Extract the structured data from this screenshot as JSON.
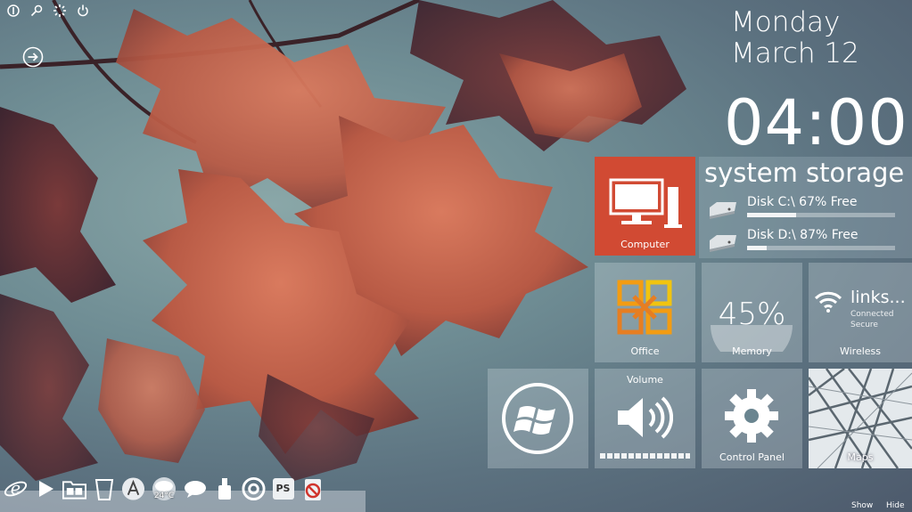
{
  "system_bar": {
    "icons": [
      "info-icon",
      "key-icon",
      "loading-spinner-icon",
      "power-icon"
    ],
    "back_icon": "circle-arrow-right-icon"
  },
  "date": {
    "day": "Monday",
    "month_day": "March 12"
  },
  "clock": {
    "time": "04:00"
  },
  "storage": {
    "title": "system storage",
    "disks": [
      {
        "label": "Disk C:\\ 67% Free",
        "free_percent": 67
      },
      {
        "label": "Disk D:\\ 87% Free",
        "free_percent": 87
      }
    ]
  },
  "tiles": {
    "computer": {
      "label": "Computer",
      "color": "#d14a33"
    },
    "office": {
      "label": "Office"
    },
    "memory": {
      "label": "Memory",
      "value": "45%",
      "usage_percent": 45
    },
    "wireless": {
      "label": "Wireless",
      "network": "links...",
      "status_lines": [
        "Connected",
        "Secure"
      ]
    },
    "windows": {
      "icon": "windows-logo-icon"
    },
    "volume": {
      "title": "Volume"
    },
    "control_panel": {
      "label": "Control Panel"
    },
    "maps": {
      "label": "Maps"
    }
  },
  "dock": {
    "items": [
      "internet-explorer-icon",
      "play-icon",
      "folder-icon",
      "recycle-bin-icon",
      "acrobat-icon",
      "weather-icon",
      "chat-bubble-icon",
      "usb-drive-icon",
      "chrome-icon",
      "photoshop-icon",
      "no-entry-icon"
    ],
    "weather_temp": "24°C",
    "photoshop_text": "PS"
  },
  "bottom_right": {
    "show": "Show",
    "hide": "Hide"
  }
}
